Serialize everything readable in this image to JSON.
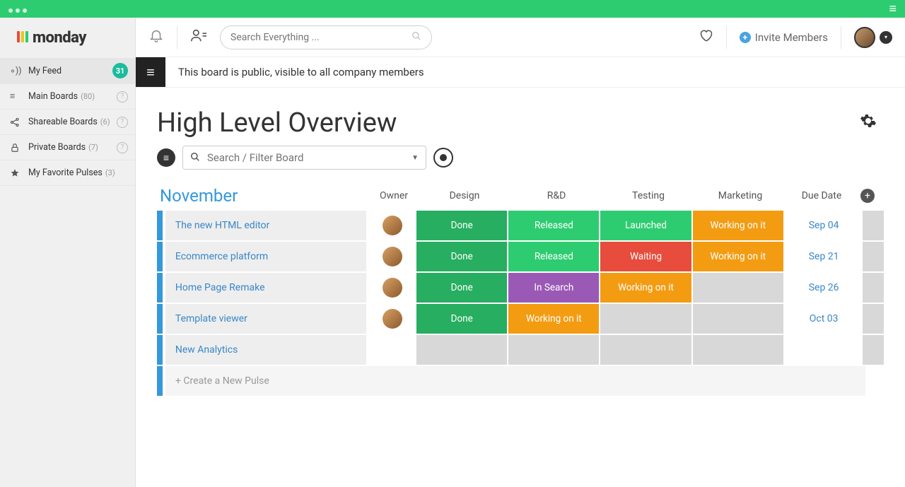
{
  "logo_text": "monday",
  "logo_bars": [
    "#e74c3c",
    "#f1c40f",
    "#2ecc71"
  ],
  "sidebar": {
    "feed": {
      "label": "My Feed",
      "badge": "31"
    },
    "sections": [
      {
        "icon": "≡",
        "label": "Main Boards",
        "count": "(80)"
      },
      {
        "icon": "share",
        "label": "Shareable Boards",
        "count": "(6)"
      },
      {
        "icon": "lock",
        "label": "Private Boards",
        "count": "(7)"
      },
      {
        "icon": "star",
        "label": "My Favorite Pulses",
        "count": "(3)"
      }
    ]
  },
  "toolbar": {
    "search_placeholder": "Search Everything ...",
    "invite": "Invite Members"
  },
  "public_msg": "This board is public, visible to all company members",
  "board_title": "High Level Overview",
  "filter_placeholder": "Search / Filter Board",
  "group": {
    "name": "November",
    "columns": [
      "Owner",
      "Design",
      "R&D",
      "Testing",
      "Marketing",
      "Due Date"
    ],
    "rows": [
      {
        "name": "The new HTML editor",
        "owner": true,
        "cells": [
          {
            "t": "Done",
            "c": "green"
          },
          {
            "t": "Released",
            "c": "green2"
          },
          {
            "t": "Launched",
            "c": "green2"
          },
          {
            "t": "Working on it",
            "c": "orange"
          }
        ],
        "date": "Sep 04"
      },
      {
        "name": "Ecommerce platform",
        "owner": true,
        "cells": [
          {
            "t": "Done",
            "c": "green"
          },
          {
            "t": "Released",
            "c": "green2"
          },
          {
            "t": "Waiting",
            "c": "red"
          },
          {
            "t": "Working on it",
            "c": "orange"
          }
        ],
        "date": "Sep 21"
      },
      {
        "name": "Home Page Remake",
        "owner": true,
        "cells": [
          {
            "t": "Done",
            "c": "green"
          },
          {
            "t": "In Search",
            "c": "purple"
          },
          {
            "t": "Working on it",
            "c": "orange"
          },
          {
            "t": "",
            "c": "empty"
          }
        ],
        "date": "Sep 26"
      },
      {
        "name": "Template viewer",
        "owner": true,
        "cells": [
          {
            "t": "Done",
            "c": "green"
          },
          {
            "t": "Working on it",
            "c": "orange"
          },
          {
            "t": "",
            "c": "empty"
          },
          {
            "t": "",
            "c": "empty"
          }
        ],
        "date": "Oct 03"
      },
      {
        "name": "New Analytics",
        "owner": false,
        "cells": [
          {
            "t": "",
            "c": "empty"
          },
          {
            "t": "",
            "c": "empty"
          },
          {
            "t": "",
            "c": "empty"
          },
          {
            "t": "",
            "c": "empty"
          }
        ],
        "date": ""
      }
    ],
    "new_pulse": "+ Create a New Pulse"
  }
}
